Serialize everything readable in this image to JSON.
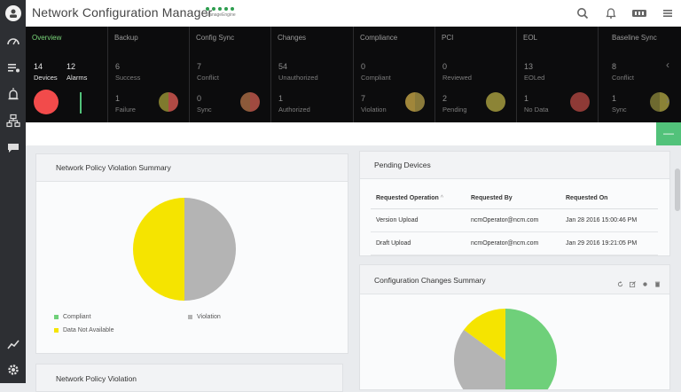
{
  "app": {
    "title": "Network Configuration Manager",
    "brand": "ManageEngine"
  },
  "summary_columns": [
    {
      "header": "Overview",
      "active": true,
      "stats": [
        {
          "value": "14",
          "label": "Devices"
        },
        {
          "value": "12",
          "label": "Alarms"
        }
      ]
    },
    {
      "header": "Backup",
      "top": {
        "value": "6",
        "label": "Success"
      },
      "bottom": {
        "value": "1",
        "label": "Failure"
      }
    },
    {
      "header": "Config Sync",
      "top": {
        "value": "7",
        "label": "Conflict"
      },
      "bottom": {
        "value": "0",
        "label": "Sync"
      }
    },
    {
      "header": "Changes",
      "top": {
        "value": "54",
        "label": "Unauthorized"
      },
      "bottom": {
        "value": "1",
        "label": "Authorized"
      }
    },
    {
      "header": "Compliance",
      "top": {
        "value": "0",
        "label": "Compliant"
      },
      "bottom": {
        "value": "7",
        "label": "Violation"
      }
    },
    {
      "header": "PCI",
      "top": {
        "value": "0",
        "label": "Reviewed"
      },
      "bottom": {
        "value": "2",
        "label": "Pending"
      }
    },
    {
      "header": "EOL",
      "top": {
        "value": "13",
        "label": "EOLed"
      },
      "bottom": {
        "value": "1",
        "label": "No Data"
      }
    },
    {
      "header": "Baseline Sync",
      "top": {
        "value": "8",
        "label": "Conflict"
      },
      "bottom": {
        "value": "1",
        "label": "Sync"
      }
    }
  ],
  "violation_card": {
    "title": "Network Policy Violation Summary",
    "legend": [
      {
        "label": "Compliant",
        "color": "#6fd07a"
      },
      {
        "label": "Violation",
        "color": "#b4b4b4"
      },
      {
        "label": "Data Not Available",
        "color": "#f5e400"
      }
    ]
  },
  "pending_card": {
    "title": "Pending Devices",
    "columns": [
      "Requested Operation",
      "Requested By",
      "Requested On"
    ],
    "sort_indicator": "^",
    "rows": [
      {
        "operation": "Version Upload",
        "by": "ncmOperator@ncm.com",
        "on": "Jan 28 2016 15:00:46 PM"
      },
      {
        "operation": "Draft Upload",
        "by": "ncmOperator@ncm.com",
        "on": "Jan 29 2016 19:21:05 PM"
      }
    ]
  },
  "changes_card": {
    "title": "Configuration Changes Summary"
  },
  "violation_card2": {
    "title": "Network Policy Violation"
  },
  "chart_data": [
    {
      "type": "pie",
      "title": "Network Policy Violation Summary",
      "categories": [
        "Violation",
        "Data Not Available"
      ],
      "values": [
        50,
        50
      ],
      "colors": [
        "#b4b4b4",
        "#f5e400"
      ]
    },
    {
      "type": "pie",
      "title": "Configuration Changes Summary",
      "categories": [
        "Compliant",
        "Violation",
        "Data Not Available"
      ],
      "values": [
        50,
        35,
        15
      ],
      "colors": [
        "#6fd07a",
        "#b4b4b4",
        "#f5e400"
      ]
    }
  ],
  "colors": {
    "accent_green": "#52c27a",
    "active_tab": "#7ad77a",
    "alarm_red": "#f24b4b"
  }
}
